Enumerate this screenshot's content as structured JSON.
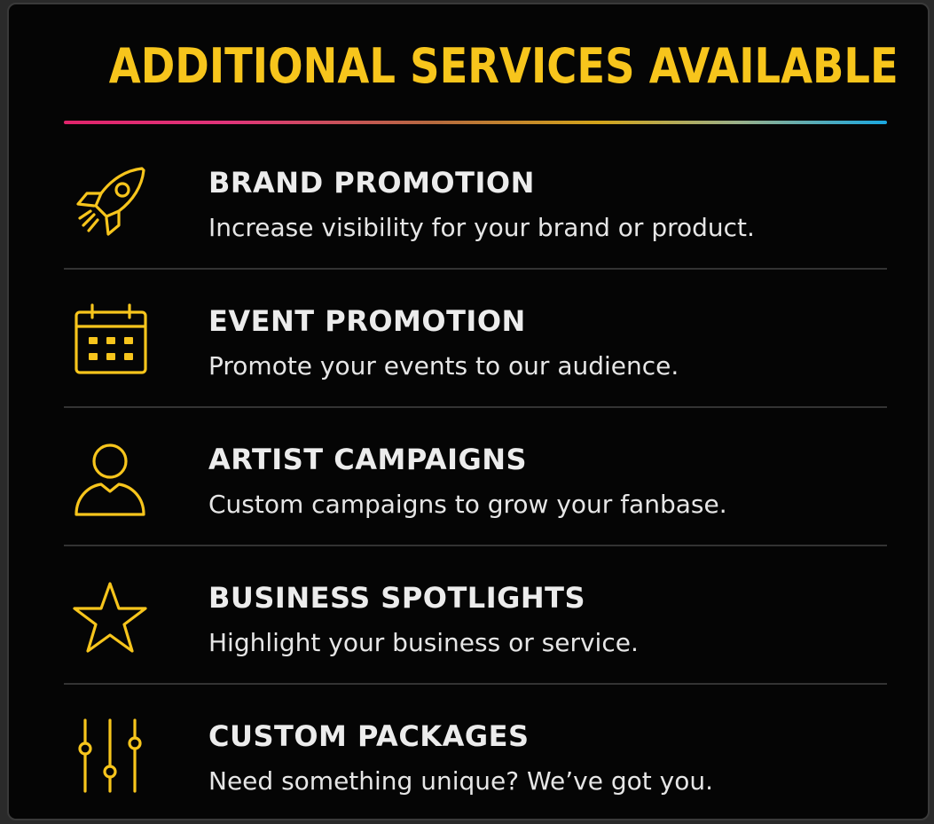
{
  "header": {
    "title": "ADDITIONAL SERVICES AVAILABLE"
  },
  "colors": {
    "accent": "#f7c51c",
    "background": "#050505",
    "text": "#ececec",
    "divider": "#333333",
    "rule_start": "#e0246b",
    "rule_end": "#1aa7e0"
  },
  "services": [
    {
      "icon": "rocket-icon",
      "title": "BRAND PROMOTION",
      "description": "Increase visibility for your brand or product."
    },
    {
      "icon": "calendar-icon",
      "title": "EVENT PROMOTION",
      "description": "Promote your events to our audience."
    },
    {
      "icon": "user-icon",
      "title": "ARTIST CAMPAIGNS",
      "description": "Custom campaigns to grow your fanbase."
    },
    {
      "icon": "star-icon",
      "title": "BUSINESS SPOTLIGHTS",
      "description": "Highlight your business or service."
    },
    {
      "icon": "sliders-icon",
      "title": "CUSTOM PACKAGES",
      "description": "Need something unique? We’ve got you."
    }
  ]
}
